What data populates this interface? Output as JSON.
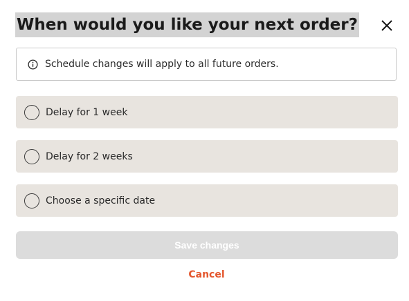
{
  "dialog": {
    "title": "When would you like your next order?",
    "close_icon": "close-icon",
    "info": {
      "icon": "info-icon",
      "text": "Schedule changes will apply to all future orders."
    },
    "options": [
      {
        "label": "Delay for 1 week",
        "selected": false
      },
      {
        "label": "Delay for 2 weeks",
        "selected": false
      },
      {
        "label": "Choose a specific date",
        "selected": false
      }
    ],
    "save_label": "Save changes",
    "save_enabled": false,
    "cancel_label": "Cancel"
  },
  "colors": {
    "option_bg": "#e8e4df",
    "save_disabled_bg": "#dcdcdc",
    "cancel_text": "#e4572e",
    "title_highlight": "#d3d3d3"
  }
}
